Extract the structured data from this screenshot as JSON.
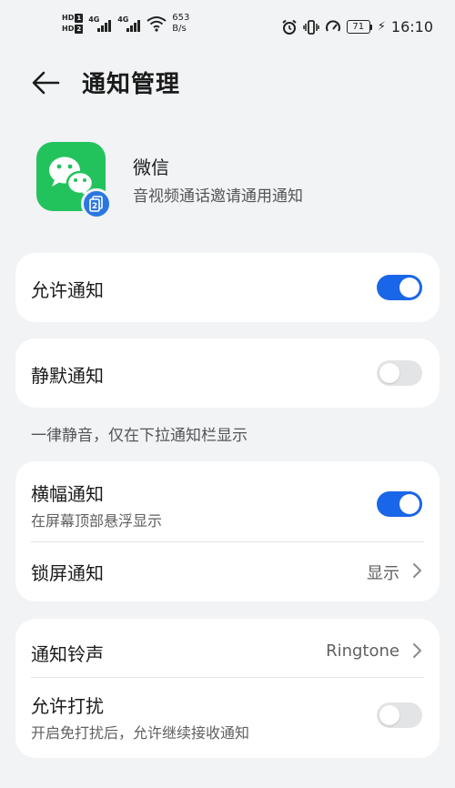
{
  "status_bar": {
    "hd1": "HD",
    "hd1_num": "1",
    "hd2": "HD",
    "hd2_num": "2",
    "sig1_tag": "4G",
    "sig2_tag": "4G",
    "speed_value": "653",
    "speed_unit": "B/s",
    "battery": "71",
    "time": "16:10"
  },
  "header": {
    "title": "通知管理"
  },
  "app": {
    "name": "微信",
    "description": "音视频通话邀请通用通知",
    "badge_number": "2",
    "icon_color": "#22c35d",
    "badge_color": "#2a77e0"
  },
  "settings": {
    "allow_notifications": {
      "label": "允许通知",
      "enabled": true
    },
    "silent_notifications": {
      "label": "静默通知",
      "enabled": false
    },
    "silent_note": "一律静音，仅在下拉通知栏显示",
    "banner_notifications": {
      "label": "横幅通知",
      "sublabel": "在屏幕顶部悬浮显示",
      "enabled": true
    },
    "lockscreen_notifications": {
      "label": "锁屏通知",
      "value": "显示"
    },
    "notification_ringtone": {
      "label": "通知铃声",
      "value": "Ringtone"
    },
    "allow_dnd": {
      "label": "允许打扰",
      "sublabel": "开启免打扰后，允许继续接收通知",
      "enabled": false
    }
  },
  "colors": {
    "background": "#f1f3f5",
    "card": "#ffffff",
    "toggle_on": "#1a66e8",
    "toggle_off": "#e3e4e6"
  }
}
